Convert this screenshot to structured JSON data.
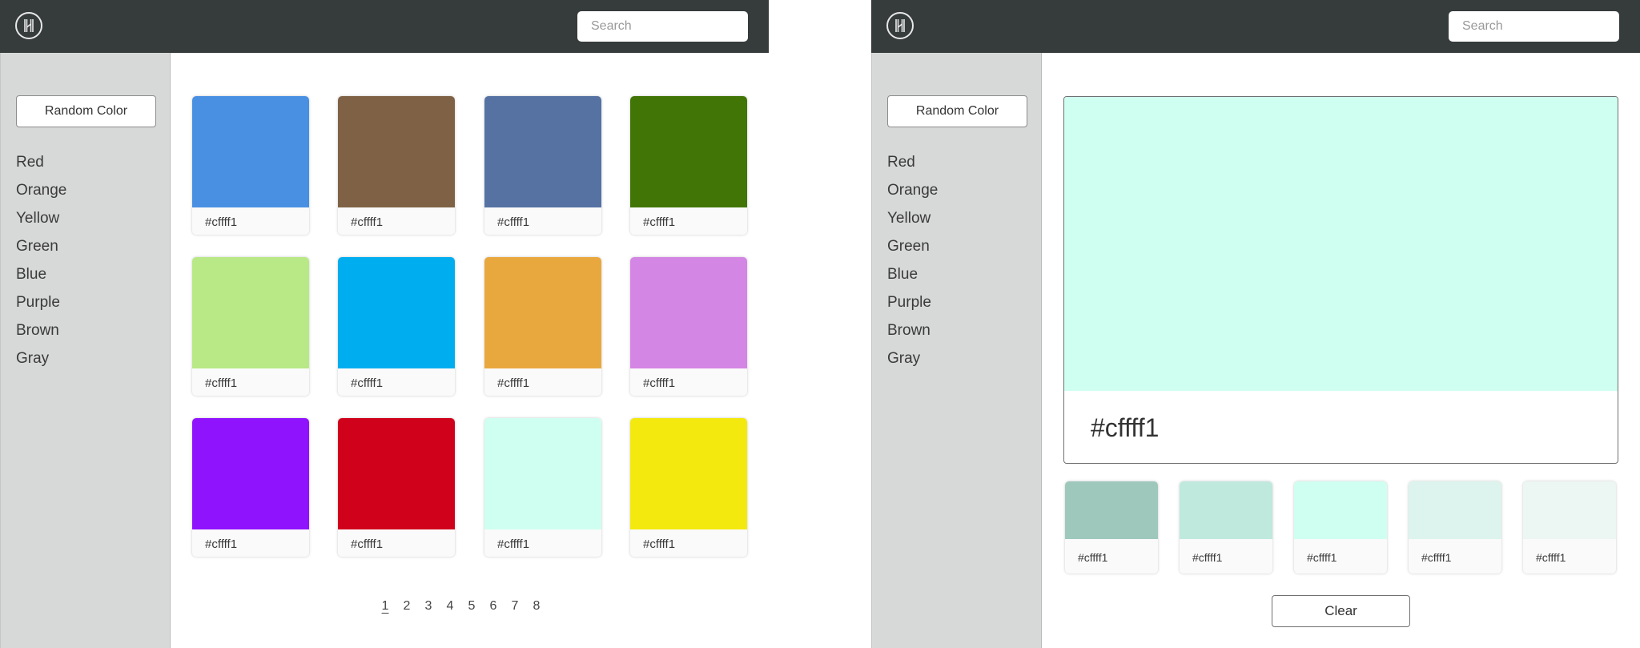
{
  "left": {
    "search": {
      "placeholder": "Search"
    },
    "sidebar": {
      "random_button": "Random Color",
      "categories": [
        "Red",
        "Orange",
        "Yellow",
        "Green",
        "Blue",
        "Purple",
        "Brown",
        "Gray"
      ]
    },
    "swatches": [
      {
        "color": "#4a90e2",
        "label": "#cffff1"
      },
      {
        "color": "#7f6245",
        "label": "#cffff1"
      },
      {
        "color": "#5572a3",
        "label": "#cffff1"
      },
      {
        "color": "#417505",
        "label": "#cffff1"
      },
      {
        "color": "#b8e986",
        "label": "#cffff1"
      },
      {
        "color": "#00aeef",
        "label": "#cffff1"
      },
      {
        "color": "#e9a83e",
        "label": "#cffff1"
      },
      {
        "color": "#d486e4",
        "label": "#cffff1"
      },
      {
        "color": "#9013fe",
        "label": "#cffff1"
      },
      {
        "color": "#d0021b",
        "label": "#cffff1"
      },
      {
        "color": "#cffff1",
        "label": "#cffff1"
      },
      {
        "color": "#f3e90e",
        "label": "#cffff1"
      }
    ],
    "pagination": {
      "pages": [
        "1",
        "2",
        "3",
        "4",
        "5",
        "6",
        "7",
        "8"
      ],
      "active": "1"
    }
  },
  "right": {
    "search": {
      "placeholder": "Search"
    },
    "sidebar": {
      "random_button": "Random Color",
      "categories": [
        "Red",
        "Orange",
        "Yellow",
        "Green",
        "Blue",
        "Purple",
        "Brown",
        "Gray"
      ]
    },
    "detail": {
      "color": "#cffff1",
      "label": "#cffff1"
    },
    "shades": [
      {
        "color": "#9ec8bc",
        "label": "#cffff1"
      },
      {
        "color": "#bfe9dd",
        "label": "#cffff1"
      },
      {
        "color": "#cffff1",
        "label": "#cffff1"
      },
      {
        "color": "#dcf4ed",
        "label": "#cffff1"
      },
      {
        "color": "#ecf6f3",
        "label": "#cffff1"
      }
    ],
    "clear_button": "Clear"
  }
}
